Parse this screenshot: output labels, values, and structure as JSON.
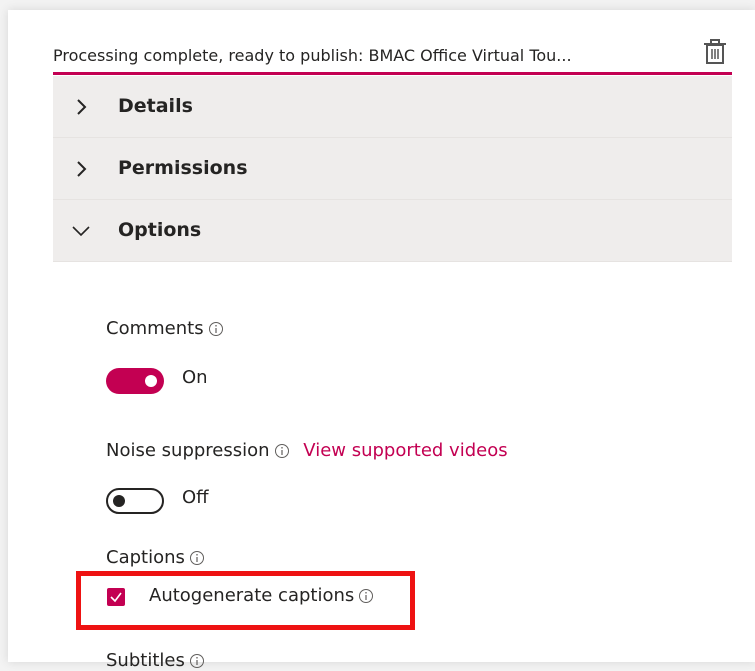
{
  "header": {
    "status_text": "Processing complete, ready to publish: BMAC Office Virtual Tou...",
    "delete_icon": "trash-icon"
  },
  "accordion": {
    "sections": [
      {
        "label": "Details",
        "expanded": false
      },
      {
        "label": "Permissions",
        "expanded": false
      },
      {
        "label": "Options",
        "expanded": true
      }
    ]
  },
  "options": {
    "comments": {
      "label": "Comments",
      "state": "On",
      "enabled": true
    },
    "noise_suppression": {
      "label": "Noise suppression",
      "link": "View supported videos",
      "state": "Off",
      "enabled": false
    },
    "captions": {
      "label": "Captions",
      "checkbox_label": "Autogenerate captions",
      "checked": true
    },
    "subtitles": {
      "label": "Subtitles"
    }
  },
  "colors": {
    "accent": "#c30052",
    "highlight": "#ee1212",
    "accordion_bg": "#efedec",
    "text": "#252423"
  }
}
